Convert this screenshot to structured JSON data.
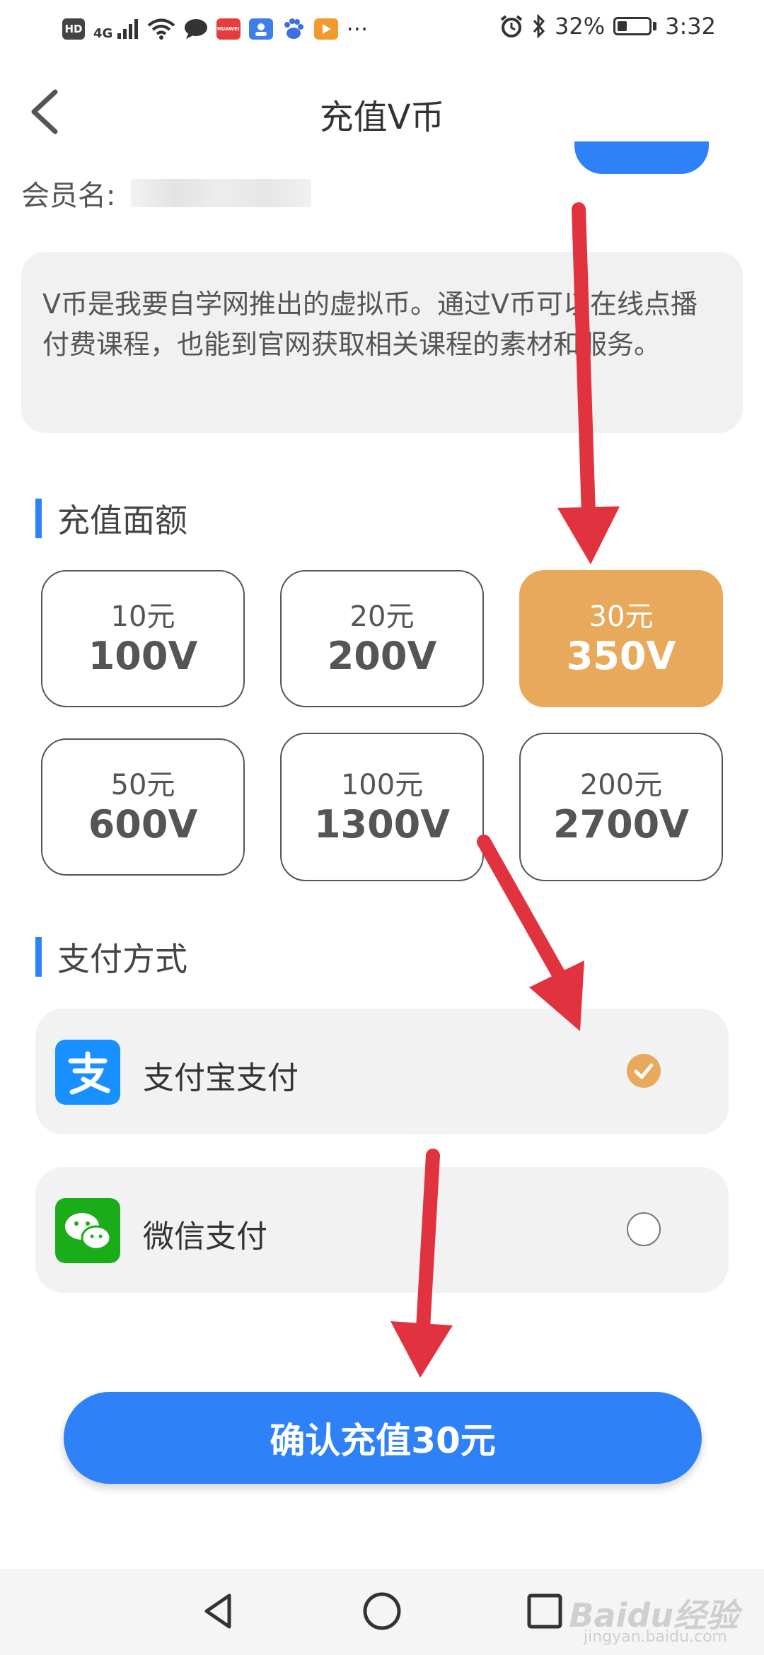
{
  "status_bar": {
    "left_icons": [
      "hd-icon",
      "signal-4g-icon",
      "wifi-icon",
      "message-icon",
      "huawei-app-icon",
      "contacts-app-icon",
      "baidu-app-icon",
      "video-app-icon",
      "more-icon"
    ],
    "hd_label": "HD",
    "net_label": "4G",
    "huawei_label": "HUAWEI",
    "more": "···",
    "battery": "32%",
    "battery_level": 0.32,
    "time": "3:32"
  },
  "header": {
    "title": "充值V币"
  },
  "member": {
    "label": "会员名:"
  },
  "description": "V币是我要自学网推出的虚拟币。通过V币可以在线点播付费课程，也能到官网获取相关课程的素材和服务。",
  "amount_section": {
    "title": "充值面额",
    "options": [
      {
        "yuan": "10元",
        "coins": "100V",
        "selected": false
      },
      {
        "yuan": "20元",
        "coins": "200V",
        "selected": false
      },
      {
        "yuan": "30元",
        "coins": "350V",
        "selected": true
      },
      {
        "yuan": "50元",
        "coins": "600V",
        "selected": false
      },
      {
        "yuan": "100元",
        "coins": "1300V",
        "selected": false
      },
      {
        "yuan": "200元",
        "coins": "2700V",
        "selected": false
      }
    ]
  },
  "payment_section": {
    "title": "支付方式",
    "methods": [
      {
        "label": "支付宝支付",
        "icon": "alipay-icon",
        "checked": true
      },
      {
        "label": "微信支付",
        "icon": "wechat-icon",
        "checked": false
      }
    ]
  },
  "confirm_button": "确认充值30元",
  "nav_bar": {
    "icons": [
      "back-triangle-icon",
      "home-circle-icon",
      "recents-square-icon"
    ]
  },
  "watermark": {
    "text": "Baidu经验",
    "sub": "jingyan.baidu.com"
  },
  "colors": {
    "accent_blue": "#2f81f7",
    "selected_orange": "#e8a95c",
    "annotation_red": "#e1333f"
  }
}
